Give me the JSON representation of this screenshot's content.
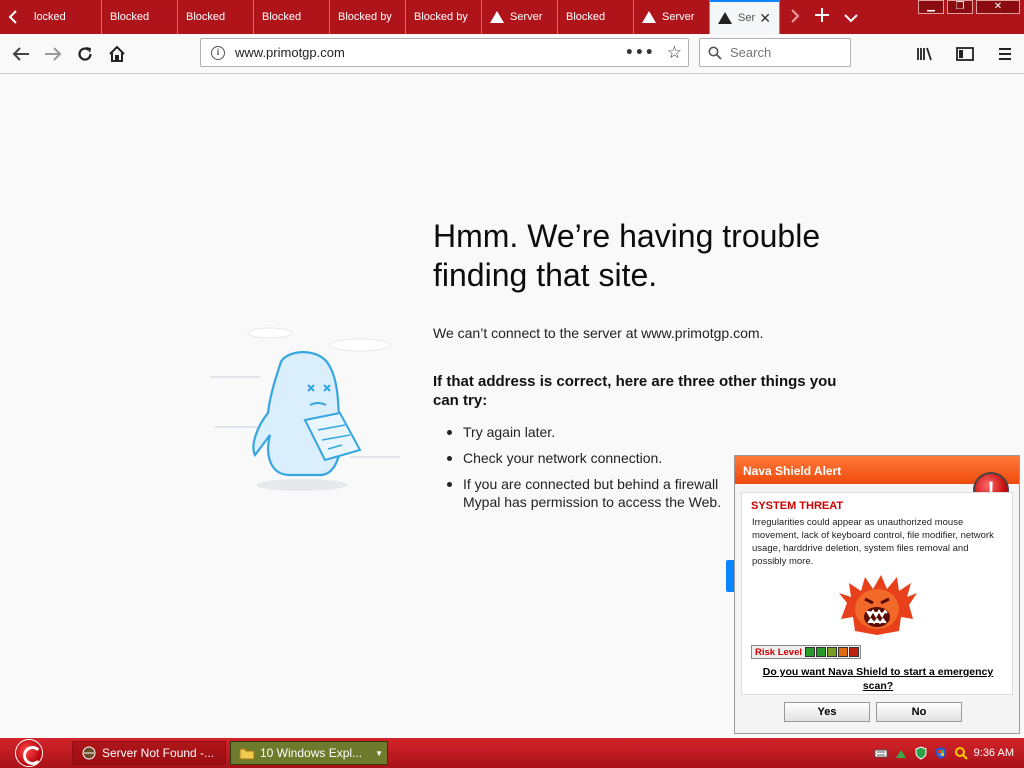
{
  "tabs": [
    {
      "label": "locked",
      "icon": ""
    },
    {
      "label": "Blocked",
      "icon": ""
    },
    {
      "label": "Blocked",
      "icon": ""
    },
    {
      "label": "Blocked",
      "icon": ""
    },
    {
      "label": "Blocked by",
      "icon": ""
    },
    {
      "label": "Blocked by",
      "icon": ""
    },
    {
      "label": "Server",
      "icon": "warning-icon"
    },
    {
      "label": "Blocked",
      "icon": ""
    },
    {
      "label": "Server",
      "icon": "warning-icon"
    },
    {
      "label": "Ser",
      "icon": "warning-icon",
      "active": true
    }
  ],
  "nav": {
    "url": "www.primotgp.com",
    "search_placeholder": "Search"
  },
  "error": {
    "title": "Hmm. We’re having trouble finding that site.",
    "description": "We can’t connect to the server at www.primotgp.com.",
    "subtitle": "If that address is correct, here are three other things you can try:",
    "items": [
      "Try again later.",
      "Check your network connection.",
      "If you are connected but behind a firewall Mypal has permission to access the Web."
    ]
  },
  "popup": {
    "header": "Nava Shield Alert",
    "threat_title": "SYSTEM THREAT",
    "threat_text": "Irregularities could appear as unauthorized mouse movement, lack of keyboard control, file modifier, network usage, harddrive deletion, system files removal and possibly more.",
    "risk_label": "Risk Level",
    "risk_colors": [
      "#2a9a2a",
      "#2a9a2a",
      "#7a9a20",
      "#e06a10",
      "#c02010"
    ],
    "question": "Do you want Nava Shield to start a emergency scan?",
    "yes_label": "Yes",
    "no_label": "No"
  },
  "taskbar": {
    "task1": "Server Not Found -...",
    "task2": "10 Windows Expl...",
    "clock": "9:36 AM"
  },
  "colors": {
    "tabstrip": "#b0141b",
    "taskbar": "#c21c23",
    "popup_header": "#f25a1a",
    "accent": "#0a84ff"
  }
}
